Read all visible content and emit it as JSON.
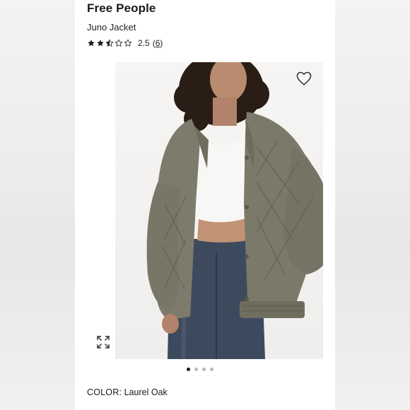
{
  "product": {
    "brand": "Free People",
    "name": "Juno Jacket",
    "rating": 2.5,
    "rating_text": "2.5",
    "review_count": "6",
    "color_label": "COLOR:",
    "color_value": "Laurel Oak"
  },
  "icons": {
    "favorite": "heart-icon",
    "expand": "expand-icon",
    "star_full": "star-full-icon",
    "star_half": "star-half-icon",
    "star_empty": "star-empty-icon"
  },
  "carousel": {
    "total_images": 4,
    "active_index": 0
  },
  "colors": {
    "jacket": "#7d7b6b",
    "text": "#1a1a1a",
    "dot_active": "#1a1a1a",
    "dot_inactive": "#b9b9b9"
  }
}
